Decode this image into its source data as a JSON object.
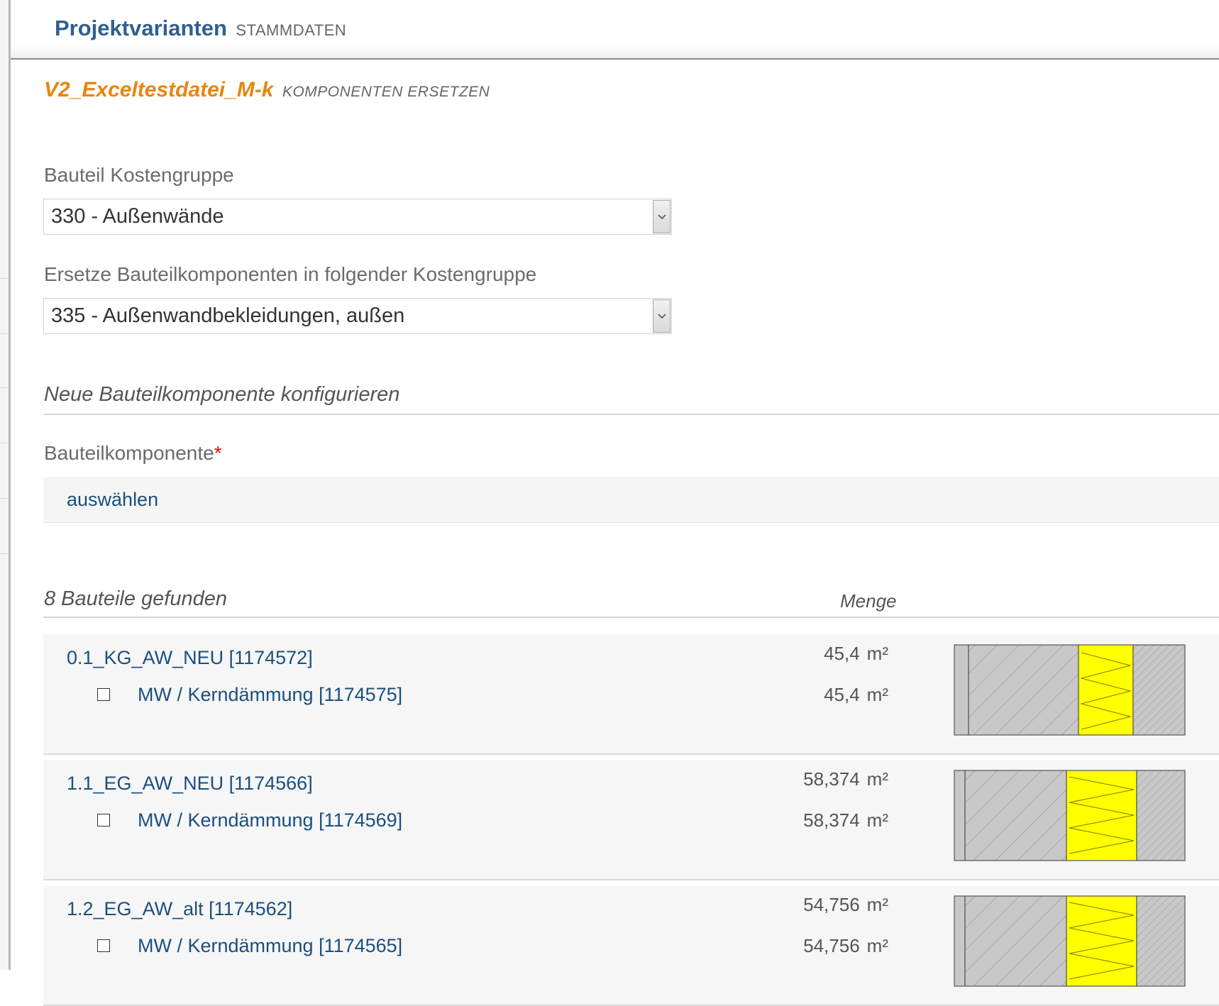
{
  "header": {
    "title": "Projektvarianten",
    "subtitle": "STAMMDATEN"
  },
  "variant": {
    "name": "V2_Exceltestdatei_M-k",
    "action": "KOMPONENTEN ERSETZEN"
  },
  "cost_group": {
    "label": "Bauteil Kostengruppe",
    "selected": "330 - Außenwände"
  },
  "replace_group": {
    "label": "Ersetze Bauteilkomponenten in folgender Kostengruppe",
    "selected": "335 - Außenwandbekleidungen, außen"
  },
  "configure": {
    "heading": "Neue Bauteilkomponente konfigurieren"
  },
  "component": {
    "label": "Bauteilkomponente",
    "required_mark": "*",
    "select_link": "auswählen"
  },
  "results": {
    "heading": "8 Bauteile gefunden",
    "quantity_col": "Menge"
  },
  "colors": {
    "wall_fill": "#c8c8c8",
    "insulation": "#ffff00",
    "link": "#1b4f7f",
    "accent": "#e7860f",
    "title": "#2f5f8e"
  },
  "items": [
    {
      "name": "0.1_KG_AW_NEU [1174572]",
      "qty": "45,4",
      "unit": "m²",
      "sub": {
        "name": "MW / Kerndämmung [1174575]",
        "qty": "45,4",
        "unit": "m²"
      }
    },
    {
      "name": "1.1_EG_AW_NEU [1174566]",
      "qty": "58,374",
      "unit": "m²",
      "sub": {
        "name": "MW / Kerndämmung [1174569]",
        "qty": "58,374",
        "unit": "m²"
      }
    },
    {
      "name": "1.2_EG_AW_alt [1174562]",
      "qty": "54,756",
      "unit": "m²",
      "sub": {
        "name": "MW / Kerndämmung [1174565]",
        "qty": "54,756",
        "unit": "m²"
      }
    }
  ]
}
